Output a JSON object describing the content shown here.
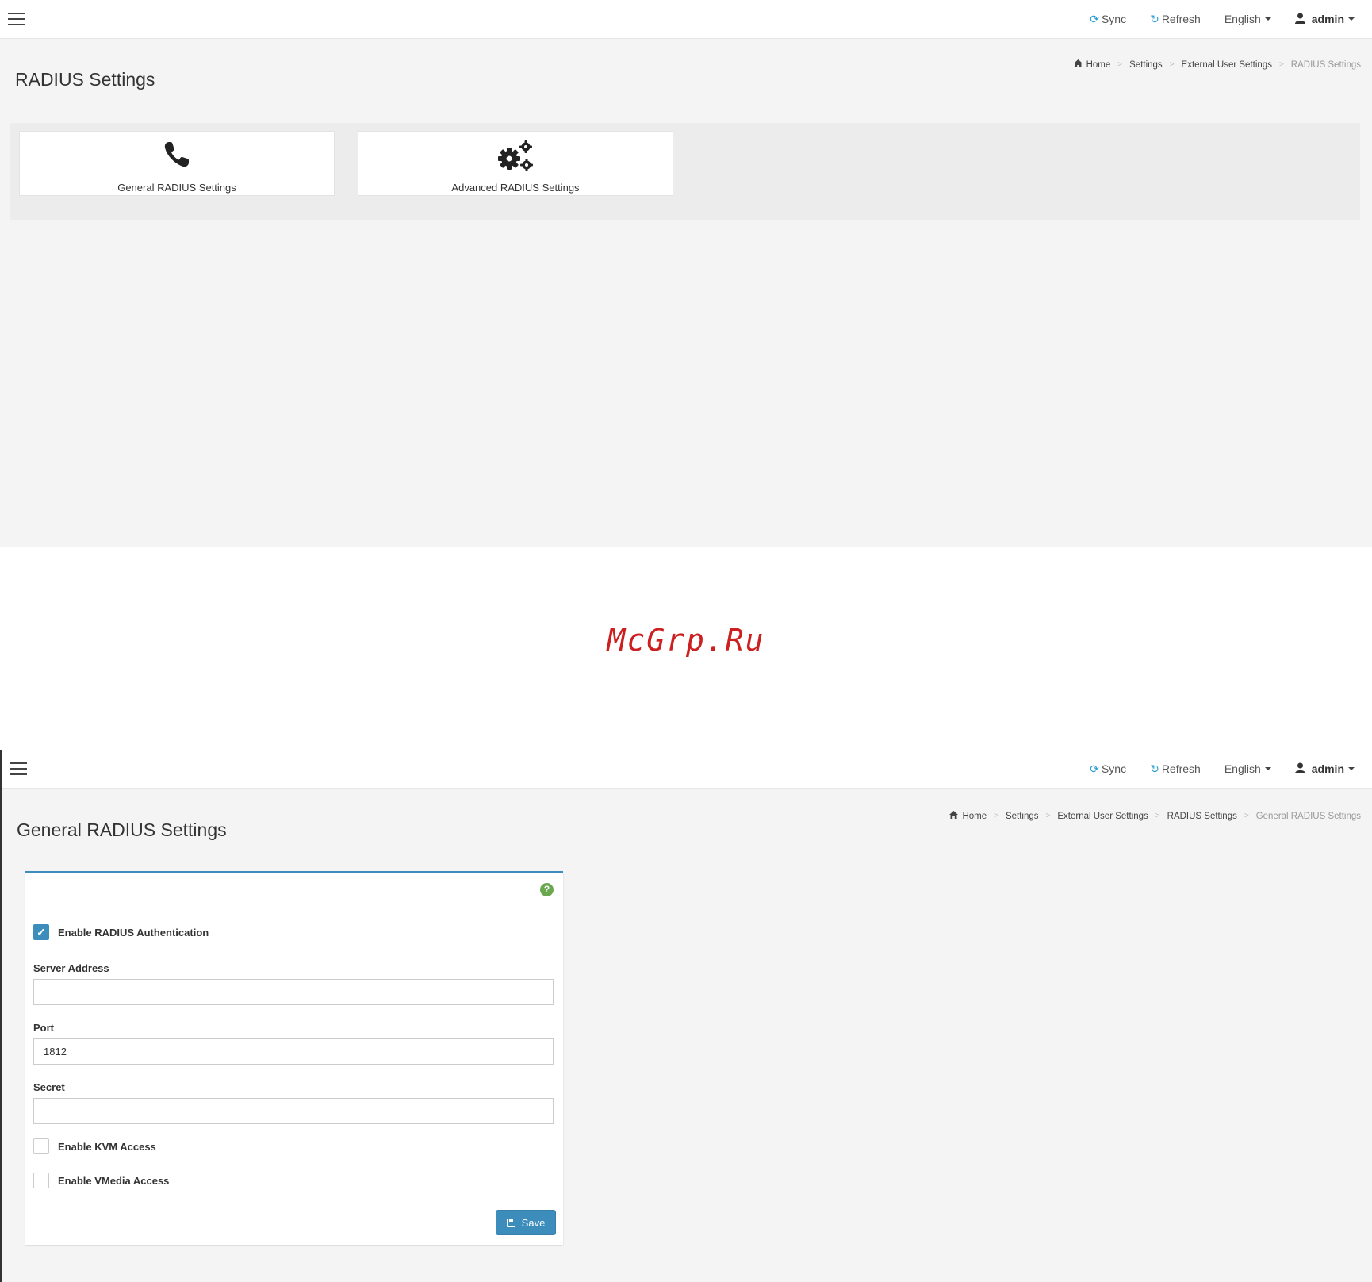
{
  "header": {
    "sync_label": "Sync",
    "refresh_label": "Refresh",
    "language_label": "English",
    "user_label": "admin"
  },
  "screen1": {
    "title": "RADIUS Settings",
    "breadcrumb": [
      "Home",
      "Settings",
      "External User Settings",
      "RADIUS Settings"
    ],
    "tiles": [
      {
        "label": "General RADIUS Settings",
        "icon": "phone-icon"
      },
      {
        "label": "Advanced RADIUS Settings",
        "icon": "gears-icon"
      }
    ]
  },
  "watermark": "McGrp.Ru",
  "screen2": {
    "title": "General RADIUS Settings",
    "breadcrumb": [
      "Home",
      "Settings",
      "External User Settings",
      "RADIUS Settings",
      "General RADIUS Settings"
    ],
    "form": {
      "help_glyph": "?",
      "enable_radius_label": "Enable RADIUS Authentication",
      "enable_radius_checked": true,
      "server_address_label": "Server Address",
      "server_address_value": "",
      "port_label": "Port",
      "port_value": "1812",
      "secret_label": "Secret",
      "secret_value": "",
      "enable_kvm_label": "Enable KVM Access",
      "enable_kvm_checked": false,
      "enable_vmedia_label": "Enable VMedia Access",
      "enable_vmedia_checked": false,
      "save_label": "Save"
    }
  },
  "colors": {
    "accent": "#3c8dbc",
    "nav_icon": "#2a9fd6",
    "help_icon": "#6aa84f",
    "watermark": "#cc1f1f"
  }
}
